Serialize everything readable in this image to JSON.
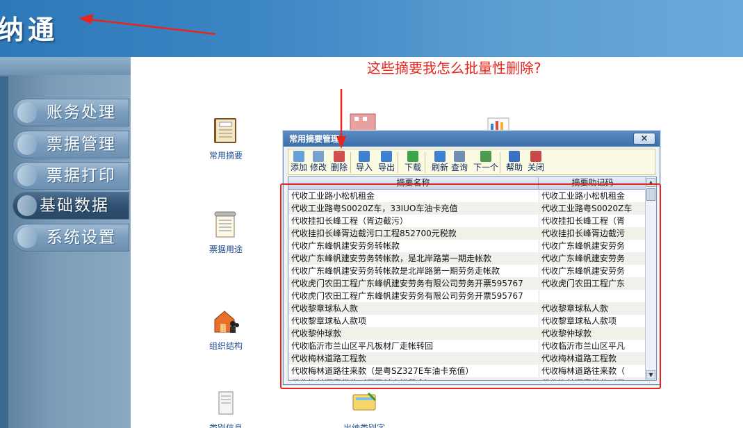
{
  "app": {
    "title": "纳通"
  },
  "annotation": {
    "text": "这些摘要我怎么批量性删除?"
  },
  "nav": [
    {
      "label": "账务处理",
      "active": false
    },
    {
      "label": "票据管理",
      "active": false
    },
    {
      "label": "票据打印",
      "active": false
    },
    {
      "label": "基础数据",
      "active": true
    },
    {
      "label": "系统设置",
      "active": false
    }
  ],
  "desktop_icons": [
    {
      "label": "常用摘要",
      "icon": "book-icon"
    },
    {
      "label": "票据用途",
      "icon": "notepad-icon"
    },
    {
      "label": "组织结构",
      "icon": "org-icon"
    },
    {
      "label": "类别信息",
      "icon": "scroll-icon"
    },
    {
      "label": "出纳类别字",
      "icon": "ticket-icon"
    }
  ],
  "dialog": {
    "title": "常用摘要管理",
    "close_label": "×",
    "toolbar": [
      {
        "label": "添加",
        "icon": "add-icon",
        "color": "#6aa0d8"
      },
      {
        "label": "修改",
        "icon": "edit-icon",
        "color": "#7a9fd1"
      },
      {
        "label": "删除",
        "icon": "delete-icon",
        "color": "#d05050"
      },
      {
        "label": "导入",
        "icon": "import-icon",
        "color": "#3f7fcf"
      },
      {
        "label": "导出",
        "icon": "export-icon",
        "color": "#3f7fcf"
      },
      {
        "label": "下载",
        "icon": "download-icon",
        "color": "#3ca348"
      },
      {
        "label": "刷新",
        "icon": "refresh-icon",
        "color": "#3f7fcf"
      },
      {
        "label": "查询",
        "icon": "query-icon",
        "color": "#6e8fb3"
      },
      {
        "label": "下一个",
        "icon": "next-icon",
        "color": "#4c9a4c"
      },
      {
        "label": "帮助",
        "icon": "help-icon",
        "color": "#3a6fc1"
      },
      {
        "label": "关闭",
        "icon": "close-doc-icon",
        "color": "#c84848"
      }
    ],
    "columns": [
      "摘要名称",
      "摘要助记码"
    ],
    "rows": [
      [
        "代收工业路小松机租金",
        "代收工业路小松机租金"
      ],
      [
        "代收工业路粤S0020Z车，33IUO车油卡充值",
        "代收工业路粤S0020Z车"
      ],
      [
        "代收挂扣长峰工程（胥边截污）",
        "代收挂扣长峰工程（胥"
      ],
      [
        "代收挂扣长峰胥边截污口工程852700元税款",
        "代收挂扣长峰胥边截污"
      ],
      [
        "代收广东峰帆建安劳务转帐款",
        "代收广东峰帆建安劳务"
      ],
      [
        "代收广东峰帆建安劳务转帐款，是北岸路第一期走帐款",
        "代收广东峰帆建安劳务"
      ],
      [
        "代收广东峰帆建安劳务转帐款是北岸路第一期劳务走帐款",
        "代收广东峰帆建安劳务"
      ],
      [
        "代收虎门农田工程广东峰帆建安劳务有限公司劳务开票595767",
        "代收虎门农田工程广东"
      ],
      [
        "代收虎门农田工程广东峰帆建安劳务有限公司劳务开票595767",
        ""
      ],
      [
        "代收黎章球私人款",
        "代收黎章球私人款"
      ],
      [
        "代收黎章球私人款项",
        "代收黎章球私人款项"
      ],
      [
        "代收黎仲球款",
        "代收黎仲球款"
      ],
      [
        "代收临沂市兰山区平凡板材厂走帐转回",
        "代收临沂市兰山区平凡"
      ],
      [
        "代收梅林道路工程款",
        "代收梅林道路工程款"
      ],
      [
        "代收梅林道路往来款（是粤SZ327E车油卡充值）",
        "代收梅林道路往来款（"
      ],
      [
        "代收梅林沥青借款（用于付小松租金）",
        "代收梅林沥青借款（用"
      ]
    ]
  }
}
